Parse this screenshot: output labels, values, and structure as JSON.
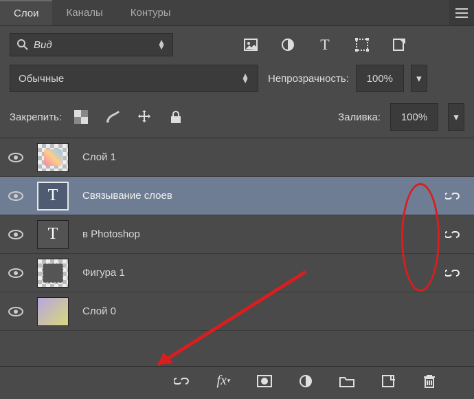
{
  "tabs": {
    "layers": "Слои",
    "channels": "Каналы",
    "paths": "Контуры"
  },
  "search": {
    "label": "Вид"
  },
  "blend": {
    "mode": "Обычные"
  },
  "opacity": {
    "label": "Непрозрачность:",
    "value": "100%"
  },
  "lock": {
    "label": "Закрепить:"
  },
  "fill": {
    "label": "Заливка:",
    "value": "100%"
  },
  "layers": [
    {
      "name": "Слой 1"
    },
    {
      "name": "Связывание слоев"
    },
    {
      "name": "в Photoshop"
    },
    {
      "name": "Фигура 1"
    },
    {
      "name": "Слой 0"
    }
  ]
}
